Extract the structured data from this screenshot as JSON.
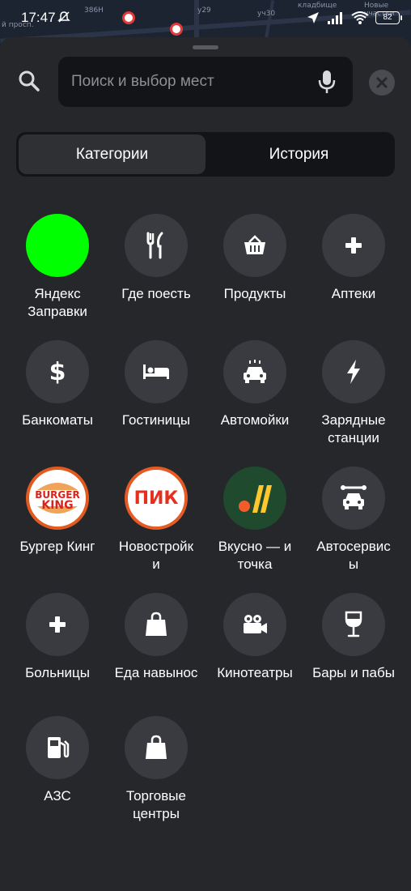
{
  "status_bar": {
    "time": "17:47",
    "battery": "82"
  },
  "map": {
    "labels": [
      "386Н",
      "у29",
      "уч30",
      "кладбище",
      "Новые участки",
      "й просп."
    ]
  },
  "search": {
    "placeholder": "Поиск и выбор мест"
  },
  "tabs": [
    {
      "label": "Категории",
      "active": true
    },
    {
      "label": "История",
      "active": false
    }
  ],
  "categories": [
    {
      "label": "Яндекс\nЗаправки",
      "icon": "green-circle-logo"
    },
    {
      "label": "Где поесть",
      "icon": "fork-knife-icon"
    },
    {
      "label": "Продукты",
      "icon": "basket-icon"
    },
    {
      "label": "Аптеки",
      "icon": "plus-icon"
    },
    {
      "label": "Банкоматы",
      "icon": "dollar-icon"
    },
    {
      "label": "Гостиницы",
      "icon": "bed-icon"
    },
    {
      "label": "Автомойки",
      "icon": "car-wash-icon"
    },
    {
      "label": "Зарядные\nстанции",
      "icon": "lightning-icon"
    },
    {
      "label": "Бургер Кинг",
      "icon": "burger-king-logo",
      "logo_text": [
        "BURGER",
        "KING"
      ]
    },
    {
      "label": "Новостройк\nи",
      "icon": "pik-logo",
      "logo_text": "ПИК"
    },
    {
      "label": "Вкусно — и\nточка",
      "icon": "vkusno-logo"
    },
    {
      "label": "Автосервис\nы",
      "icon": "car-service-icon"
    },
    {
      "label": "Больницы",
      "icon": "plus-icon"
    },
    {
      "label": "Еда навынос",
      "icon": "bag-icon"
    },
    {
      "label": "Кинотеатры",
      "icon": "camera-icon"
    },
    {
      "label": "Бары и пабы",
      "icon": "wine-glass-icon"
    },
    {
      "label": "АЗС",
      "icon": "fuel-icon"
    },
    {
      "label": "Торговые\nцентры",
      "icon": "bag-icon"
    }
  ],
  "colors": {
    "background": "#26272b",
    "field": "#131417",
    "circle": "#3a3b40",
    "yandex_fuel": "#00ff00",
    "burger_king": "#e35a1f",
    "pik": "#e65a24",
    "vkusno_bg": "#1f4a2e"
  }
}
